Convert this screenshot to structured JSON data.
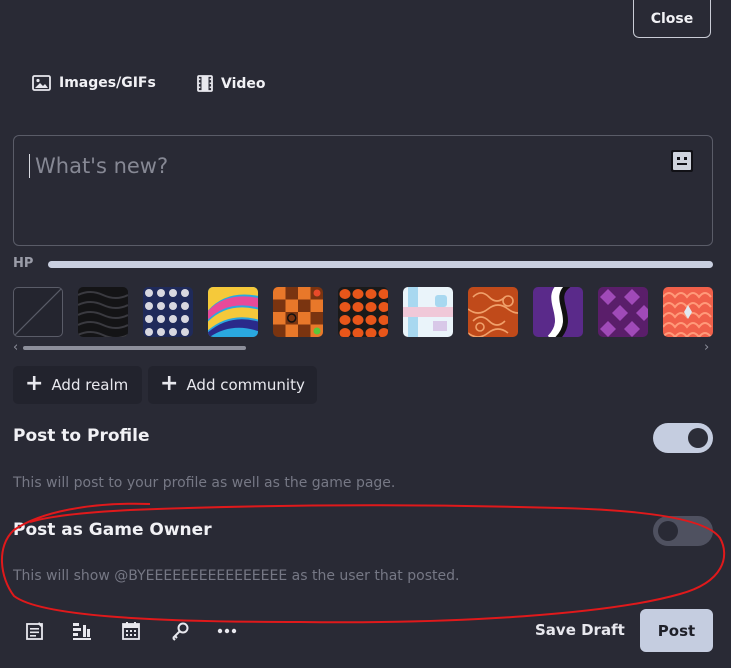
{
  "header": {
    "close_label": "Close"
  },
  "media_tabs": [
    {
      "label": "Images/GIFs",
      "icon": "image-icon"
    },
    {
      "label": "Video",
      "icon": "film-icon"
    }
  ],
  "composer": {
    "placeholder": "What's new?",
    "emoji_icon": "emoji-icon"
  },
  "hp": {
    "label": "HP"
  },
  "backgrounds": [
    {
      "name": "none",
      "colors": [
        "#24252f",
        "#5a5c68"
      ]
    },
    {
      "name": "black-ripples",
      "colors": [
        "#141416",
        "#3a3a40"
      ]
    },
    {
      "name": "skulls",
      "colors": [
        "#1f2a5a",
        "#d8d8e0"
      ]
    },
    {
      "name": "retro-waves",
      "colors": [
        "#e84a9a",
        "#f5c93a",
        "#2aa8e0"
      ]
    },
    {
      "name": "checker-board",
      "colors": [
        "#e8782a",
        "#7a3410"
      ]
    },
    {
      "name": "pumpkins",
      "colors": [
        "#e8561a",
        "#1a1a1a"
      ]
    },
    {
      "name": "pastel-pipes",
      "colors": [
        "#a8d8f0",
        "#f0c8d8"
      ]
    },
    {
      "name": "orange-swirls",
      "colors": [
        "#c04a1a",
        "#e88a4a"
      ]
    },
    {
      "name": "purple-twist",
      "colors": [
        "#5a2a8a",
        "#ffffff",
        "#111111"
      ]
    },
    {
      "name": "purple-gems",
      "colors": [
        "#5a1e6a",
        "#a04ab8"
      ]
    },
    {
      "name": "coral-scales",
      "colors": [
        "#f0604a",
        "#ff9a7a"
      ]
    }
  ],
  "tags": {
    "add_realm": "Add realm",
    "add_community": "Add community"
  },
  "options": {
    "post_to_profile": {
      "title": "Post to Profile",
      "description": "This will post to your profile as well as the game page.",
      "enabled": true
    },
    "post_as_owner": {
      "title": "Post as Game Owner",
      "description": "This will show @BYEEEEEEEEEEEEEEEE as the user that posted.",
      "enabled": false
    }
  },
  "annotation": {
    "color": "#e0191b"
  },
  "toolbar": {
    "icons": [
      "article-icon",
      "chart-icon",
      "calendar-icon",
      "key-icon",
      "more-icon"
    ],
    "save_draft": "Save Draft",
    "post": "Post"
  }
}
